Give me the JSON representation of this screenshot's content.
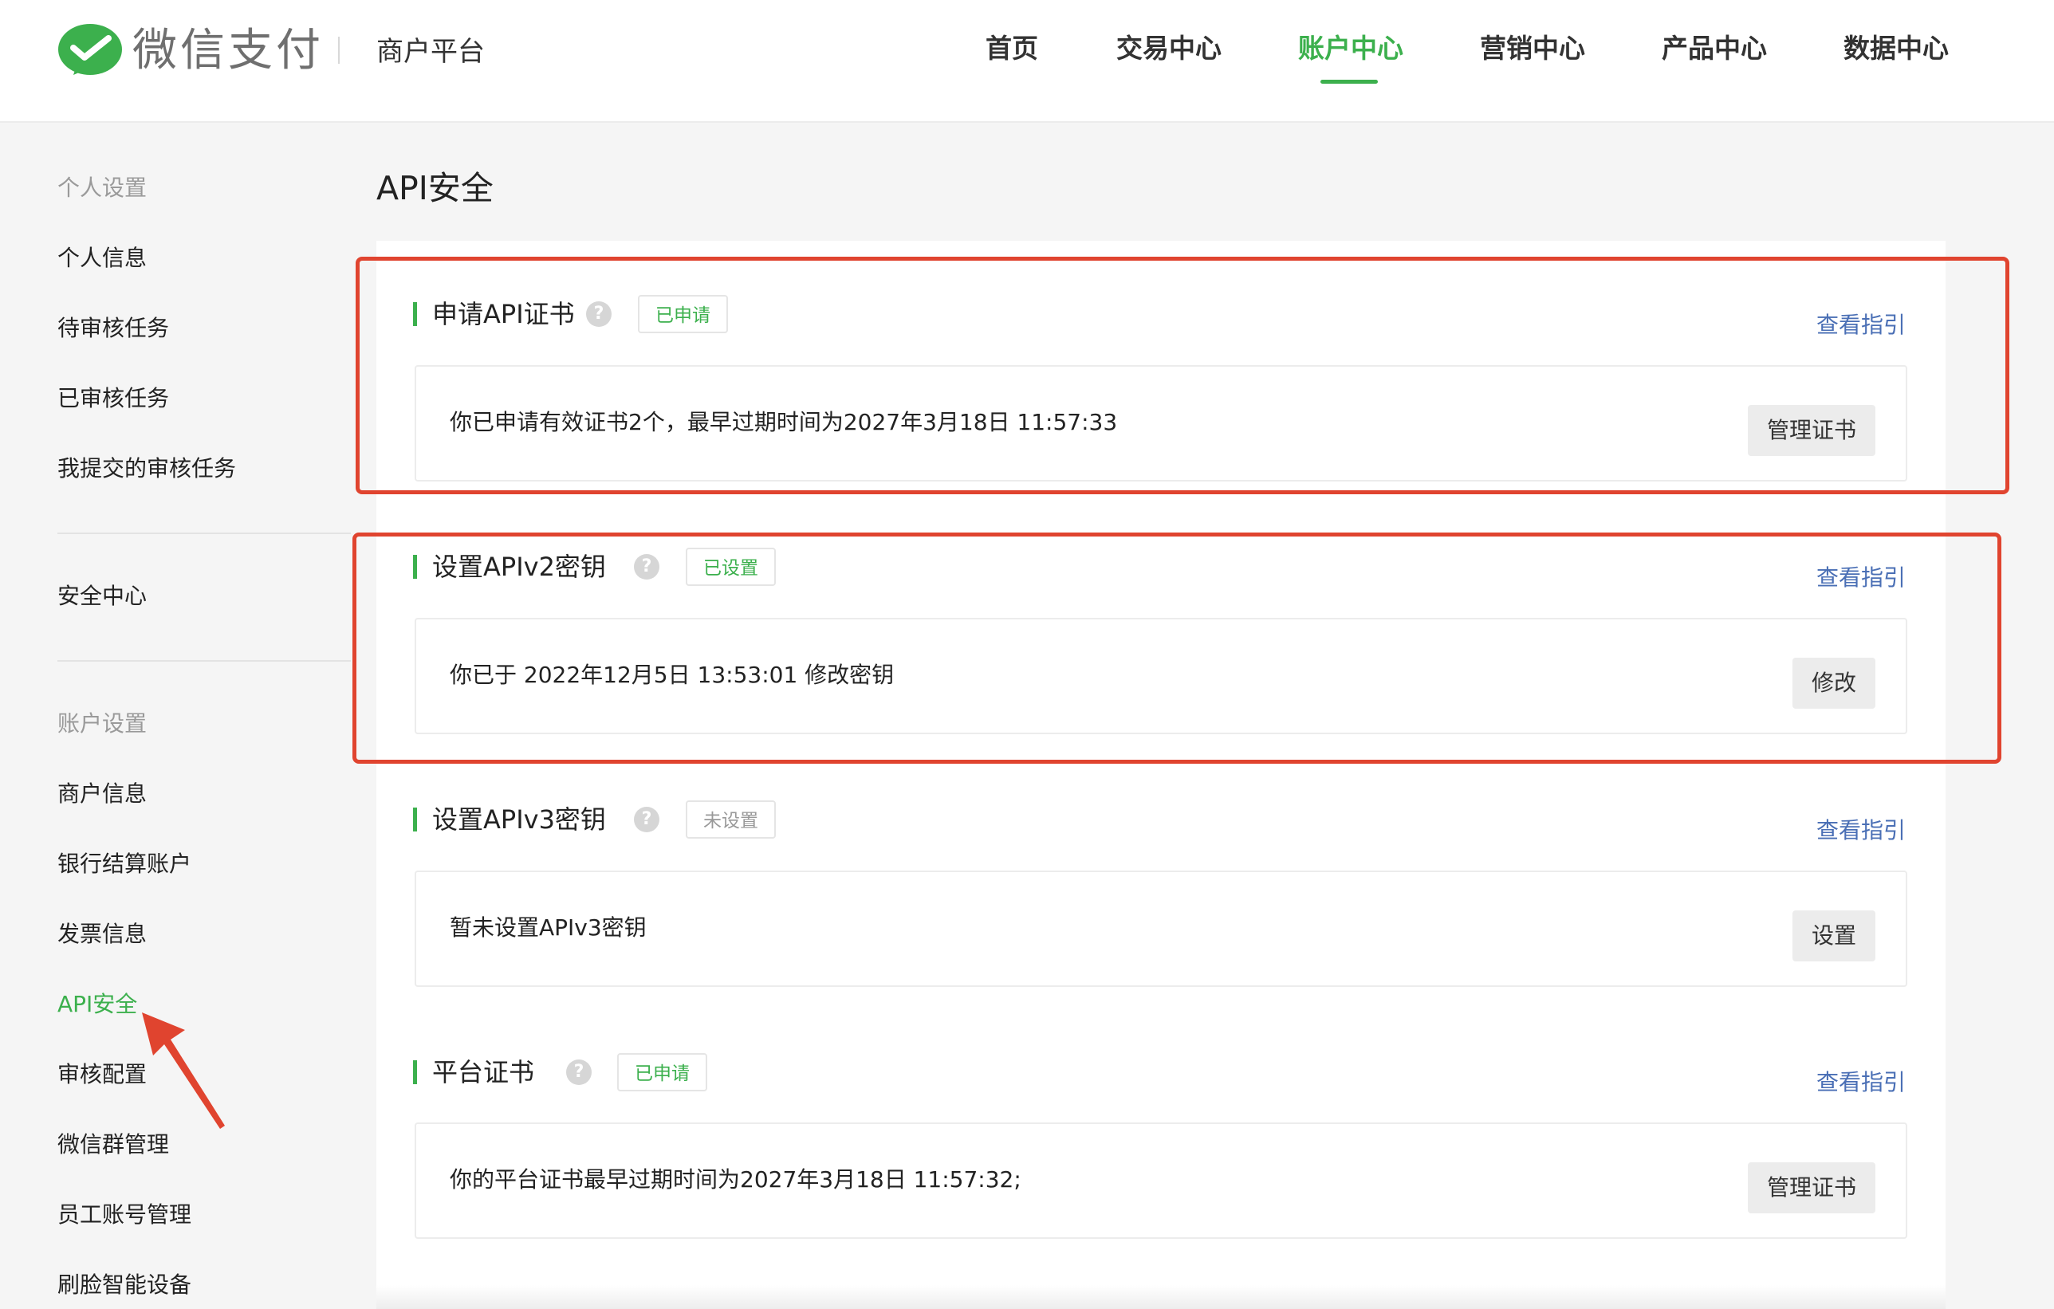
{
  "header": {
    "logo_text": "微信支付",
    "platform": "商户平台",
    "nav": [
      "首页",
      "交易中心",
      "账户中心",
      "营销中心",
      "产品中心",
      "数据中心"
    ],
    "active_nav": "账户中心"
  },
  "sidebar": {
    "group1_title": "个人设置",
    "group1_items": [
      "个人信息",
      "待审核任务",
      "已审核任务",
      "我提交的审核任务"
    ],
    "security_center": "安全中心",
    "group2_title": "账户设置",
    "group2_items": [
      "商户信息",
      "银行结算账户",
      "发票信息",
      "API安全",
      "审核配置",
      "微信群管理",
      "员工账号管理",
      "刷脸智能设备"
    ],
    "active_item": "API安全"
  },
  "main": {
    "page_title": "API安全",
    "sections": [
      {
        "title": "申请API证书",
        "status": "已申请",
        "guide": "查看指引",
        "info": "你已申请有效证书2个，最早过期时间为2027年3月18日 11:57:33",
        "button": "管理证书"
      },
      {
        "title": "设置APIv2密钥",
        "status": "已设置",
        "guide": "查看指引",
        "info": "你已于 2022年12月5日 13:53:01 修改密钥",
        "button": "修改"
      },
      {
        "title": "设置APIv3密钥",
        "status": "未设置",
        "guide": "查看指引",
        "info": "暂未设置APIv3密钥",
        "button": "设置"
      },
      {
        "title": "平台证书",
        "status": "已申请",
        "guide": "查看指引",
        "info": "你的平台证书最早过期时间为2027年3月18日 11:57:32;",
        "button": "管理证书"
      }
    ],
    "help_glyph": "?"
  },
  "colors": {
    "accent": "#3cb04d",
    "link": "#4a6fb5",
    "highlight": "#e0442f"
  }
}
